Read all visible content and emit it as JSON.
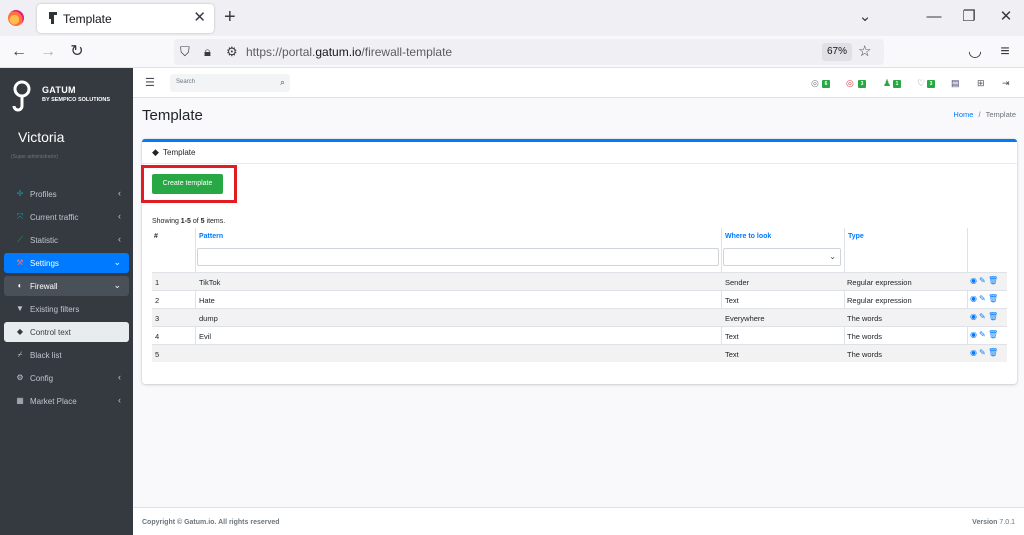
{
  "browser": {
    "tab_title": "Template",
    "url_prefix": "https://portal.",
    "url_domain": "gatum.io",
    "url_path": "/firewall-template",
    "zoom": "67%"
  },
  "sidebar": {
    "brand_name": "GATUM",
    "brand_sub": "BY SEMPICO SOLUTIONS",
    "user_name": "Victoria",
    "user_role": "(Super administrator)",
    "items": [
      {
        "label": "Profiles",
        "icon": "profiles-icon"
      },
      {
        "label": "Current traffic",
        "icon": "traffic-icon"
      },
      {
        "label": "Statistic",
        "icon": "chart-icon"
      },
      {
        "label": "Settings",
        "icon": "settings-icon"
      },
      {
        "label": "Firewall",
        "icon": "shield-icon"
      },
      {
        "label": "Existing filters",
        "icon": "filter-icon"
      },
      {
        "label": "Control text",
        "icon": "eraser-icon"
      },
      {
        "label": "Black list",
        "icon": "broom-icon"
      },
      {
        "label": "Config",
        "icon": "gear-icon"
      },
      {
        "label": "Market Place",
        "icon": "grid-icon"
      }
    ]
  },
  "header": {
    "search_placeholder": "Search",
    "badges": [
      "6",
      "3",
      "1",
      "3"
    ]
  },
  "page": {
    "title": "Template",
    "breadcrumb_home": "Home",
    "breadcrumb_sep": "/",
    "breadcrumb_current": "Template",
    "card_title": "Template",
    "create_button": "Create template",
    "summary_prefix": "Showing ",
    "summary_range": "1-5",
    "summary_mid": " of ",
    "summary_total": "5",
    "summary_suffix": " items."
  },
  "table": {
    "columns": [
      "#",
      "Pattern",
      "Where to look",
      "Type"
    ],
    "rows": [
      {
        "num": "1",
        "pattern": "TikTok",
        "where": "Sender",
        "type": "Regular expression"
      },
      {
        "num": "2",
        "pattern": "Hate",
        "where": "Text",
        "type": "Regular expression"
      },
      {
        "num": "3",
        "pattern": "dump",
        "where": "Everywhere",
        "type": "The words"
      },
      {
        "num": "4",
        "pattern": "Evil",
        "where": "Text",
        "type": "The words"
      },
      {
        "num": "5",
        "pattern": "",
        "where": "Text",
        "type": "The words"
      }
    ]
  },
  "footer": {
    "copyright": "Copyright © Gatum.io. All rights reserved",
    "version_label": "Version",
    "version": "7.0.1"
  },
  "colors": {
    "primary": "#007bff",
    "success": "#28a745",
    "sidebar": "#343a40",
    "highlight": "#e31b23"
  }
}
